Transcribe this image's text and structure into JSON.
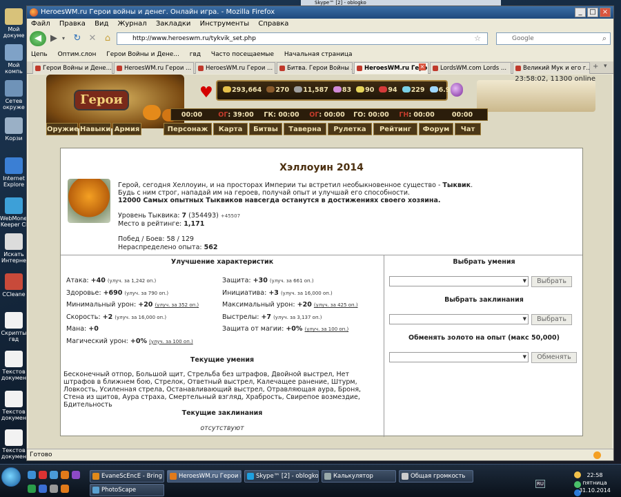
{
  "desktop": {
    "icons": [
      {
        "label": "Мой докуме"
      },
      {
        "label": "Мой компь"
      },
      {
        "label": "Сетев окруже"
      },
      {
        "label": "Корзи"
      },
      {
        "label": "Internet Explore"
      },
      {
        "label": "WebMoney Keeper Cl"
      },
      {
        "label": "Искать Интерне"
      },
      {
        "label": "CCleane"
      },
      {
        "label": "Скрипты гвд"
      },
      {
        "label": "Текстов докумен"
      },
      {
        "label": "Текстов докумен"
      },
      {
        "label": "Текстов докумен"
      }
    ]
  },
  "bg_windows": {
    "skype_title": "Skype™ [2] - oblogko"
  },
  "browser": {
    "title": "HeroesWM.ru Герои войны и денег. Онлайн игра. - Mozilla Firefox",
    "menu": [
      "Файл",
      "Правка",
      "Вид",
      "Журнал",
      "Закладки",
      "Инструменты",
      "Справка"
    ],
    "url": "http://www.heroeswm.ru/tykvik_set.php",
    "search_placeholder": "Google",
    "bookmarks": [
      "Цепь",
      "Оптим.слон",
      "Герои Войны и Дене...",
      "гвд",
      "Часто посещаемые",
      "Начальная страница"
    ],
    "tabs": [
      {
        "label": "Герои Войны и Дене..."
      },
      {
        "label": "HeroesWM.ru Герои ..."
      },
      {
        "label": "HeroesWM.ru Герои ..."
      },
      {
        "label": "Битва. Герои Войны ..."
      },
      {
        "label": "HeroesWM.ru Геро..."
      },
      {
        "label": "LordsWM.com Lords ..."
      },
      {
        "label": "Великий Мук и его г..."
      }
    ],
    "status": "Готово"
  },
  "game": {
    "logo": "Герои",
    "clock": "23:58:02, 11300 online",
    "resources": [
      "293,664",
      "270",
      "11,587",
      "83",
      "90",
      "94",
      "229",
      "6.9"
    ],
    "resource_colors": [
      "#e6c14a",
      "#8a5a2b",
      "#a0a0a0",
      "#d08ad8",
      "#e5d35a",
      "#d43a3a",
      "#7ad0e6",
      "#9fd7ff"
    ],
    "timers": [
      {
        "pre": "00:00",
        "red": "",
        "post": ""
      },
      {
        "pre": "",
        "red": "ОГ",
        "post": ": 39:00"
      },
      {
        "pre": "ГК: 00:00",
        "red": "",
        "post": ""
      },
      {
        "pre": "",
        "red": "ОГ",
        "post": ": 00:00"
      },
      {
        "pre": "ГО: 00:00",
        "red": "",
        "post": ""
      },
      {
        "pre": "",
        "red": "ГН",
        "post": ": 00:00"
      },
      {
        "pre": "00:00",
        "red": "",
        "post": ""
      }
    ],
    "left_menu": [
      "Оружие",
      "Навыки",
      "Армия"
    ],
    "main_menu": [
      "Персонаж",
      "Карта",
      "Битвы",
      "Таверна",
      "Рулетка",
      "Рейтинг",
      "Форум",
      "Чат"
    ],
    "event": {
      "title": "Хэллоуин 2014",
      "intro_1": "Герой, сегодня Хеллоуин, и на просторах Империи ты встретил необыкновенное существо - ",
      "intro_name": "Тыквик",
      "intro_1_end": ".",
      "intro_2": "Будь с ним строг, нападай им на героев, получай опыт и улучшай его способности.",
      "intro_3": "12000 Самых опытных Тыквиков навсегда останутся в достижениях своего хозяина.",
      "level_label": "Уровень Тыквика:",
      "level": "7",
      "level_exp": "(354493)",
      "level_next": "+45507",
      "rank_label": "Место в рейтинге:",
      "rank": "1,171",
      "wins_label": "Побед / Боев:",
      "wins": "58 / 129",
      "free_label": "Нераспределено опыта:",
      "free_exp": "562"
    },
    "improve_title": "Улучшение характеристик",
    "characteristics_left": [
      {
        "label": "Атака:",
        "value": "+40",
        "cost": "(улуч. за 1,242 оп.)",
        "link": false
      },
      {
        "label": "Здоровье:",
        "value": "+690",
        "cost": "(улуч. за 790 оп.)",
        "link": false
      },
      {
        "label": "Минимальный урон:",
        "value": "+20",
        "cost": "(улуч. за 352 оп.)",
        "link": true
      },
      {
        "label": "Скорость:",
        "value": "+2",
        "cost": "(улуч. за 16,000 оп.)",
        "link": false
      },
      {
        "label": "Мана:",
        "value": "+0",
        "cost": "",
        "link": false
      },
      {
        "label": "Магический урон:",
        "value": "+0%",
        "cost": "(улуч. за 100 оп.)",
        "link": true
      }
    ],
    "characteristics_right": [
      {
        "label": "Защита:",
        "value": "+30",
        "cost": "(улуч. за 661 оп.)",
        "link": false
      },
      {
        "label": "Инициатива:",
        "value": "+3",
        "cost": "(улуч. за 16,000 оп.)",
        "link": false
      },
      {
        "label": "Максимальный урон:",
        "value": "+20",
        "cost": "(улуч. за 425 оп.)",
        "link": true
      },
      {
        "label": "Выстрелы:",
        "value": "+7",
        "cost": "(улуч. за 3,137 оп.)",
        "link": false
      },
      {
        "label": "Защита от магии:",
        "value": "+0%",
        "cost": "(улуч. за 100 оп.)",
        "link": true
      }
    ],
    "current_skills_title": "Текущие умения",
    "current_skills": "Бесконечный отпор, Большой щит, Стрельба без штрафов, Двойной выстрел, Нет штрафов в ближнем бою, Стрелок, Ответный выстрел, Калечащее ранение, Штурм, Ловкость, Усиленная стрела, Останавливающий выстрел, Отравляющая аура, Броня, Стена из щитов, Аура страха, Смертельный взгляд, Храбрость, Свирепое возмездие, Бдительность",
    "current_spells_title": "Текущие заклинания",
    "current_spells": "отсутствуют",
    "choose_skills_title": "Выбрать умения",
    "choose_spells_title": "Выбрать заклинания",
    "exchange_title": "Обменять золото на опыт (макс 50,000)",
    "choose_button": "Выбрать",
    "exchange_button": "Обменять"
  },
  "taskbar": {
    "items": [
      {
        "label": "EvaneScEncE - Bring ..."
      },
      {
        "label": "HeroesWM.ru Герои в..."
      },
      {
        "label": "Skype™ [2] - oblogko"
      },
      {
        "label": "Калькулятор"
      },
      {
        "label": "Общая громкость"
      },
      {
        "label": "PhotoScape"
      }
    ],
    "lang": "RU",
    "time": "22:58",
    "day": "пятница",
    "date": "31.10.2014"
  }
}
